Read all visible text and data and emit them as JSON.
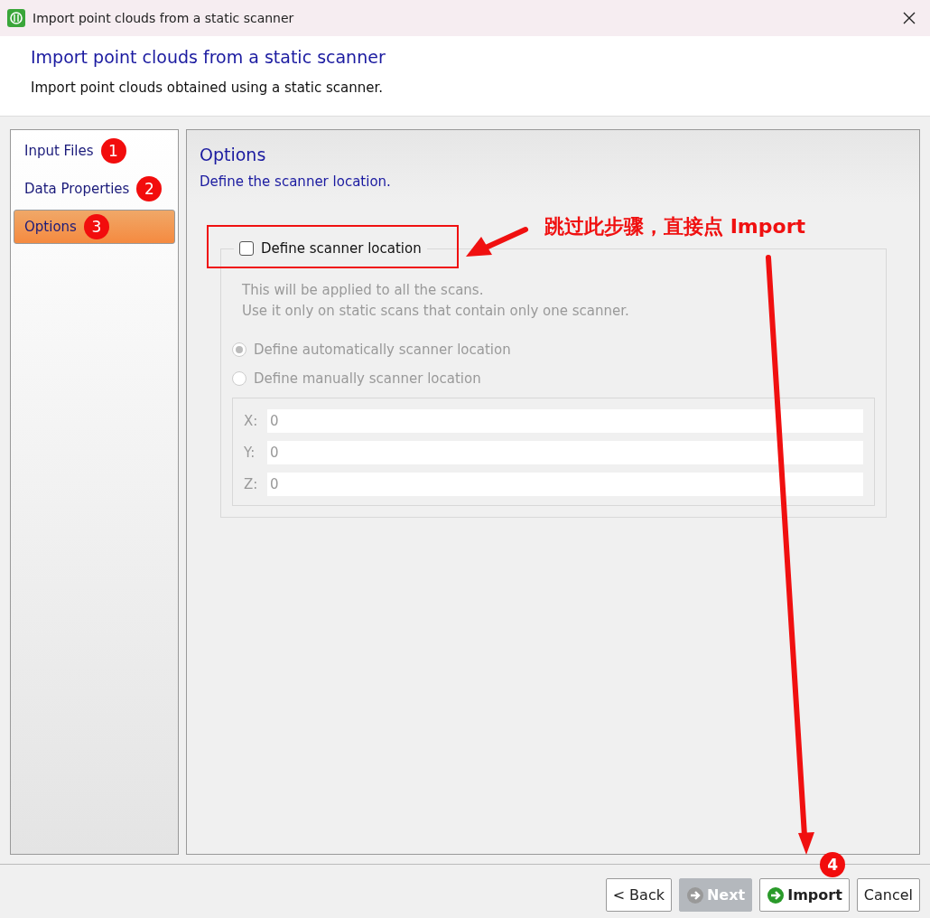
{
  "window": {
    "title": "Import point clouds from a static scanner"
  },
  "header": {
    "title": "Import point clouds from a static scanner",
    "subtitle": "Import point clouds obtained using a static scanner."
  },
  "steps": [
    {
      "label": "Input Files",
      "selected": false,
      "badge": "1"
    },
    {
      "label": "Data Properties",
      "selected": false,
      "badge": "2"
    },
    {
      "label": "Options",
      "selected": true,
      "badge": "3"
    }
  ],
  "page": {
    "title": "Options",
    "subtitle": "Define the scanner location."
  },
  "scanner_group": {
    "checkbox": {
      "label": "Define scanner location",
      "checked": false
    },
    "disabled": true,
    "notes": [
      "This will be applied to all the scans.",
      "Use it only on static scans that contain only one scanner."
    ],
    "radios": [
      {
        "label": "Define automatically scanner location",
        "selected": true
      },
      {
        "label": "Define manually scanner location",
        "selected": false
      }
    ],
    "coordinates": [
      {
        "label": "X:",
        "value": "0"
      },
      {
        "label": "Y:",
        "value": "0"
      },
      {
        "label": "Z:",
        "value": "0"
      }
    ]
  },
  "buttons": [
    {
      "kind": "back",
      "label": "< Back",
      "disabled": false
    },
    {
      "kind": "next",
      "label": "Next",
      "disabled": true
    },
    {
      "kind": "import",
      "label": "Import",
      "disabled": false,
      "badge": "4"
    },
    {
      "kind": "cancel",
      "label": "Cancel",
      "disabled": false
    }
  ],
  "callout": {
    "text": "跳过此步骤，直接点 Import"
  }
}
